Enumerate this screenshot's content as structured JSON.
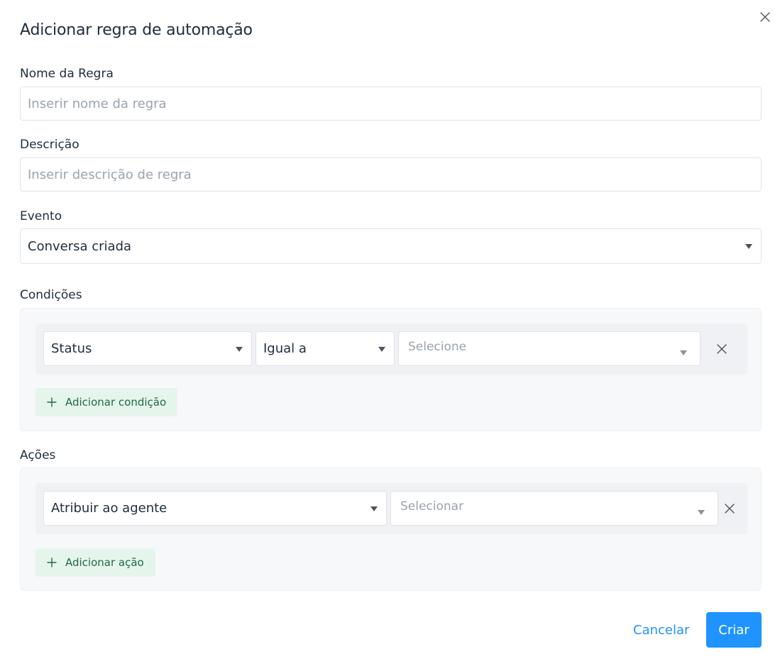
{
  "modal": {
    "title": "Adicionar regra de automação",
    "close_icon": "close-icon"
  },
  "form": {
    "name": {
      "label": "Nome da Regra",
      "placeholder": "Inserir nome da regra",
      "value": ""
    },
    "description": {
      "label": "Descrição",
      "placeholder": "Inserir descrição de regra",
      "value": ""
    },
    "event": {
      "label": "Evento",
      "value": "Conversa criada"
    }
  },
  "conditions": {
    "label": "Condições",
    "rows": [
      {
        "attribute": "Status",
        "operator": "Igual a",
        "value_placeholder": "Selecione"
      }
    ],
    "add_label": "Adicionar condição"
  },
  "actions": {
    "label": "Ações",
    "rows": [
      {
        "action": "Atribuir ao agente",
        "value_placeholder": "Selecionar"
      }
    ],
    "add_label": "Adicionar ação"
  },
  "footer": {
    "cancel_label": "Cancelar",
    "submit_label": "Criar"
  },
  "colors": {
    "primary": "#1f93ff",
    "success_bg": "#e6f5ec",
    "success_text": "#1e6b45",
    "panel_bg": "#f7f8fa"
  }
}
